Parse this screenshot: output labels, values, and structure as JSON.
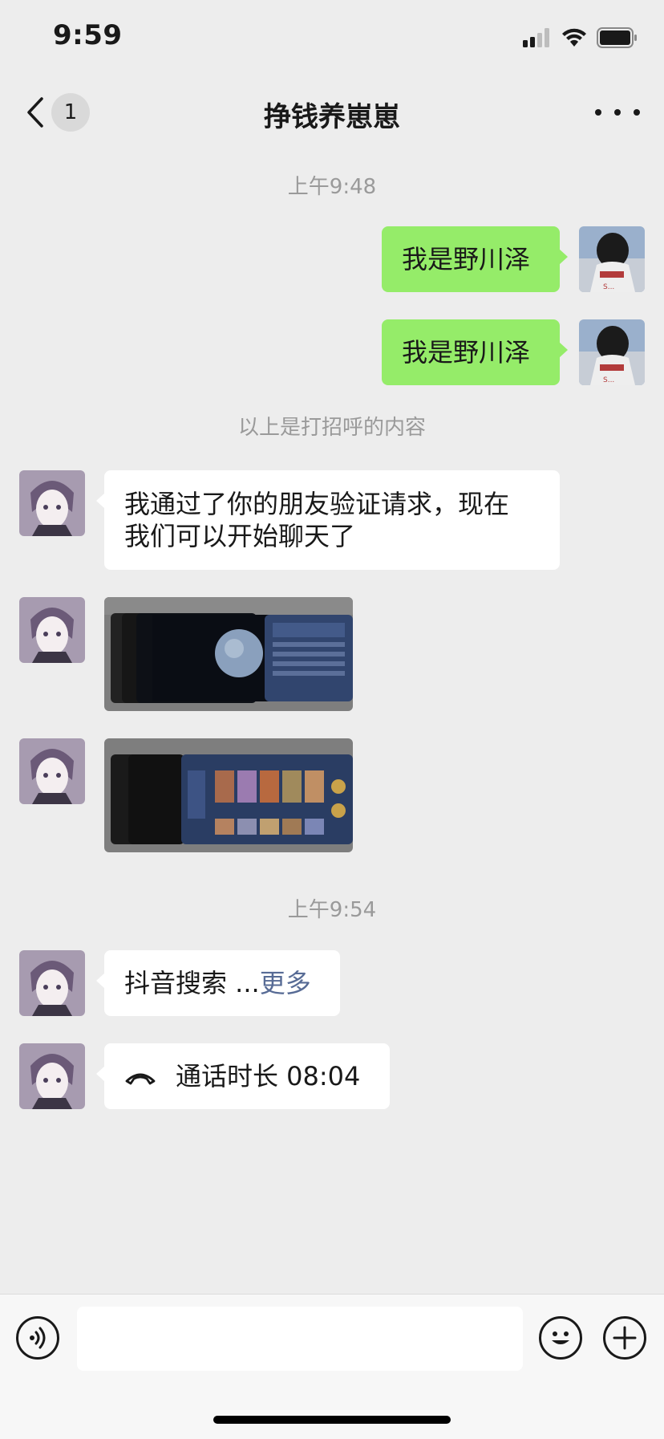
{
  "status_bar": {
    "time": "9:59"
  },
  "nav": {
    "unread_count": "1",
    "title": "挣钱养崽崽"
  },
  "messages": {
    "timestamp_1": "上午9:48",
    "me_1": "我是野川泽",
    "me_2": "我是野川泽",
    "system_1": "以上是打招呼的内容",
    "other_1_line1": "我通过了你的朋友验证请求，现在",
    "other_1_line2": "我们可以开始聊天了",
    "timestamp_2": "上午9:54",
    "douyin_text": "抖音搜索 ...",
    "douyin_more": "更多",
    "call_text": "通话时长 08:04"
  },
  "input": {
    "placeholder": ""
  },
  "colors": {
    "my_bubble": "#95ec69",
    "their_bubble": "#ffffff",
    "background": "#ededed",
    "link": "#576b95"
  }
}
